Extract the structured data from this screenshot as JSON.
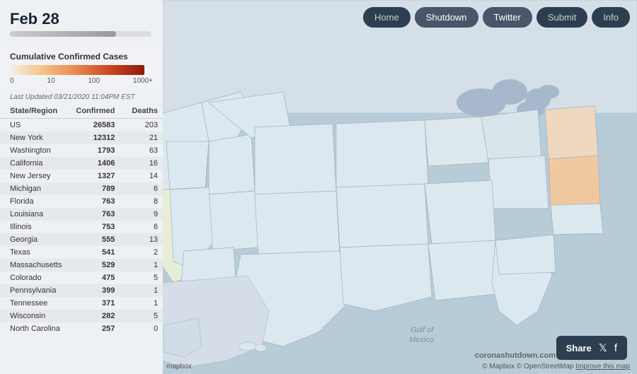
{
  "header": {
    "date": "Feb 28",
    "progress": 75
  },
  "nav": {
    "items": [
      {
        "label": "Home",
        "active": false
      },
      {
        "label": "Shutdown",
        "active": true
      },
      {
        "label": "Twitter",
        "active": true
      },
      {
        "label": "Submit",
        "active": false
      },
      {
        "label": "Info",
        "active": false
      }
    ]
  },
  "legend": {
    "title": "Cumulative Confirmed Cases",
    "labels": [
      "0",
      "10",
      "100",
      "1000+"
    ]
  },
  "last_updated": "Last Updated 03/21/2020 11:04PM EST",
  "table": {
    "headers": [
      "State/Region",
      "Confirmed",
      "Deaths"
    ],
    "rows": [
      {
        "state": "US",
        "confirmed": "26583",
        "deaths": "203"
      },
      {
        "state": "New York",
        "confirmed": "12312",
        "deaths": "21"
      },
      {
        "state": "Washington",
        "confirmed": "1793",
        "deaths": "63"
      },
      {
        "state": "California",
        "confirmed": "1406",
        "deaths": "16"
      },
      {
        "state": "New Jersey",
        "confirmed": "1327",
        "deaths": "14"
      },
      {
        "state": "Michigan",
        "confirmed": "789",
        "deaths": "6"
      },
      {
        "state": "Florida",
        "confirmed": "763",
        "deaths": "8"
      },
      {
        "state": "Louisiana",
        "confirmed": "763",
        "deaths": "9"
      },
      {
        "state": "Illinois",
        "confirmed": "753",
        "deaths": "6"
      },
      {
        "state": "Georgia",
        "confirmed": "555",
        "deaths": "13"
      },
      {
        "state": "Texas",
        "confirmed": "541",
        "deaths": "2"
      },
      {
        "state": "Massachusetts",
        "confirmed": "529",
        "deaths": "1"
      },
      {
        "state": "Colorado",
        "confirmed": "475",
        "deaths": "5"
      },
      {
        "state": "Pennsylvania",
        "confirmed": "399",
        "deaths": "1"
      },
      {
        "state": "Tennessee",
        "confirmed": "371",
        "deaths": "1"
      },
      {
        "state": "Wisconsin",
        "confirmed": "282",
        "deaths": "5"
      },
      {
        "state": "North Carolina",
        "confirmed": "257",
        "deaths": "0"
      }
    ]
  },
  "share": {
    "label": "Share"
  },
  "footer": {
    "mapbox": "mapbox",
    "copyright": "© Mapbox © OpenStreetMap",
    "improve": "Improve this map",
    "watermark": "coronashutdown.com"
  }
}
